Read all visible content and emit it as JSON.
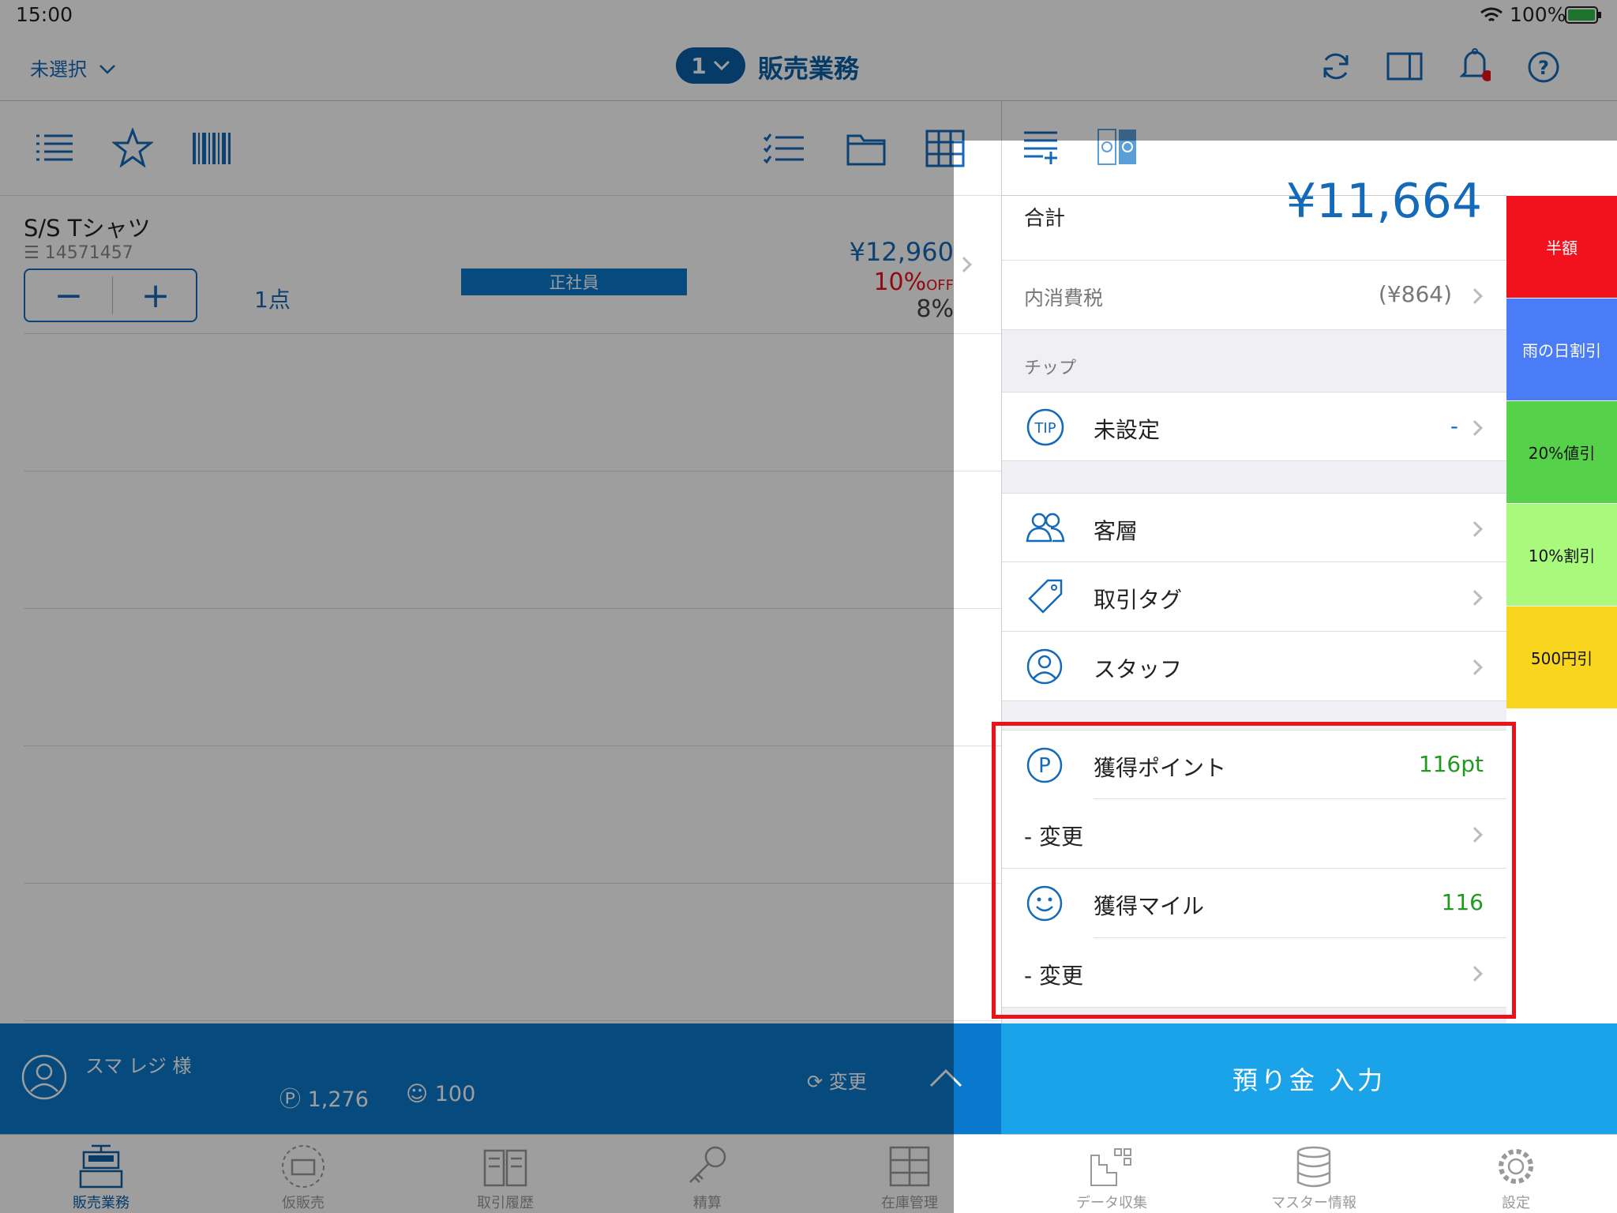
{
  "status": {
    "time": "15:00",
    "battery": "100%"
  },
  "header": {
    "store_select": "未選択",
    "count_badge": "1",
    "title": "販売業務"
  },
  "item": {
    "name": "S/S Tシャツ",
    "code": "14571457",
    "qty": "1点",
    "tag": "正社員",
    "price": "¥12,960",
    "discount_pct": "10%",
    "discount_off": "OFF",
    "tax": "8%"
  },
  "summary": {
    "total_label": "合計",
    "total_value": "¥11,664",
    "tax_label": "内消費税",
    "tax_value": "(¥864)"
  },
  "tip": {
    "section": "チップ",
    "label": "未設定",
    "value": "-",
    "icon_text": "TIP"
  },
  "rows": {
    "segment": "客層",
    "tag": "取引タグ",
    "staff": "スタッフ"
  },
  "points": {
    "label": "獲得ポイント",
    "value": "116pt",
    "change": "- 変更"
  },
  "miles": {
    "label": "獲得マイル",
    "value": "116",
    "change": "- 変更"
  },
  "discounts": [
    {
      "label": "半額",
      "color": "#f1121d"
    },
    {
      "label": "雨の日割引",
      "color": "#4a7cf8"
    },
    {
      "label": "20%値引",
      "color": "#56d14a"
    },
    {
      "label": "10%割引",
      "color": "#a8f97c"
    },
    {
      "label": "500円引",
      "color": "#f7d61d"
    }
  ],
  "customer": {
    "name": "スマ レジ 様",
    "points": "1,276",
    "miles": "100",
    "change": "変更"
  },
  "deposit": "預り金 入力",
  "tabs": [
    "販売業務",
    "仮販売",
    "取引履歴",
    "精算",
    "在庫管理",
    "",
    "データ収集",
    "マスター情報",
    "設定"
  ]
}
